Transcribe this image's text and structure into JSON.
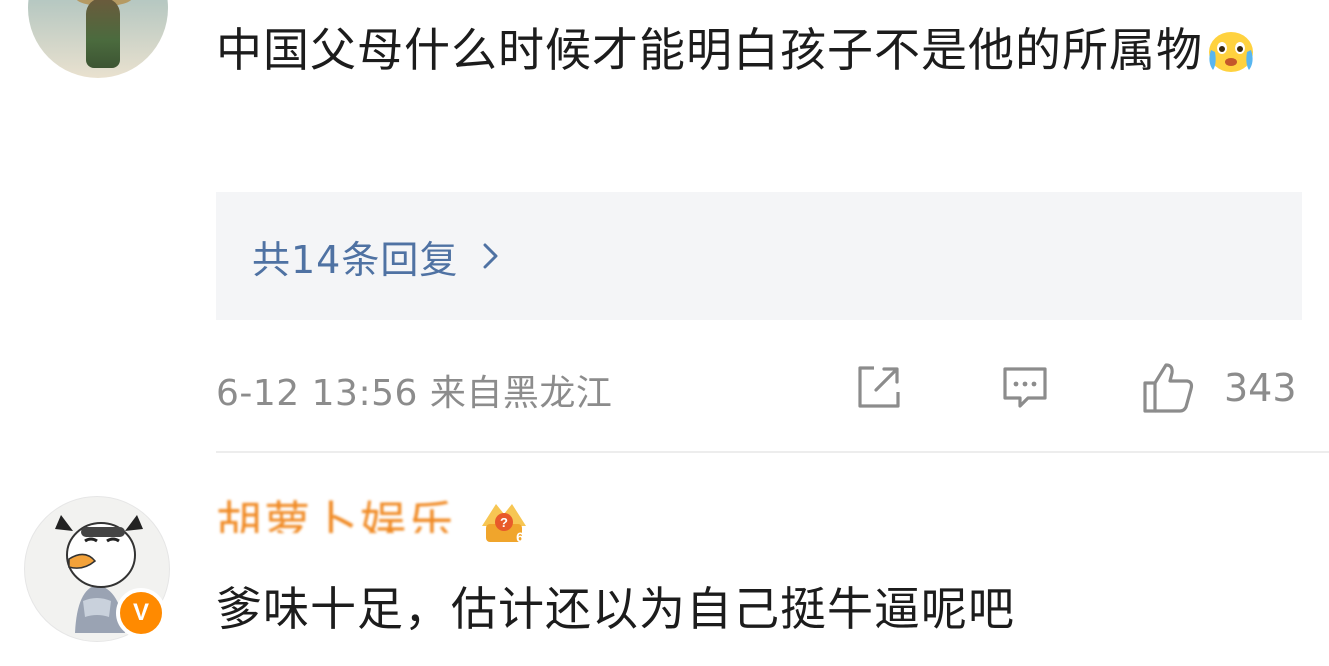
{
  "comment1": {
    "text": "中国父母什么时候才能明白孩子不是他的所属物",
    "emoji": "crying-face-emoji",
    "replies_label": "共14条回复",
    "meta": "6-12 13:56 来自黑龙江",
    "likes": "343"
  },
  "comment2": {
    "username": "胡萝卜娱乐",
    "level": "6",
    "vip_badge": "V",
    "text": "爹味十足，估计还以为自己挺牛逼呢吧"
  },
  "icons": {
    "share": "share-icon",
    "reply": "comment-icon",
    "like": "thumbs-up-icon"
  },
  "colors": {
    "link_blue": "#4f72a3",
    "meta_gray": "#8c8c8c",
    "username_orange": "#f08a24",
    "vip_orange": "#ff8a00"
  }
}
